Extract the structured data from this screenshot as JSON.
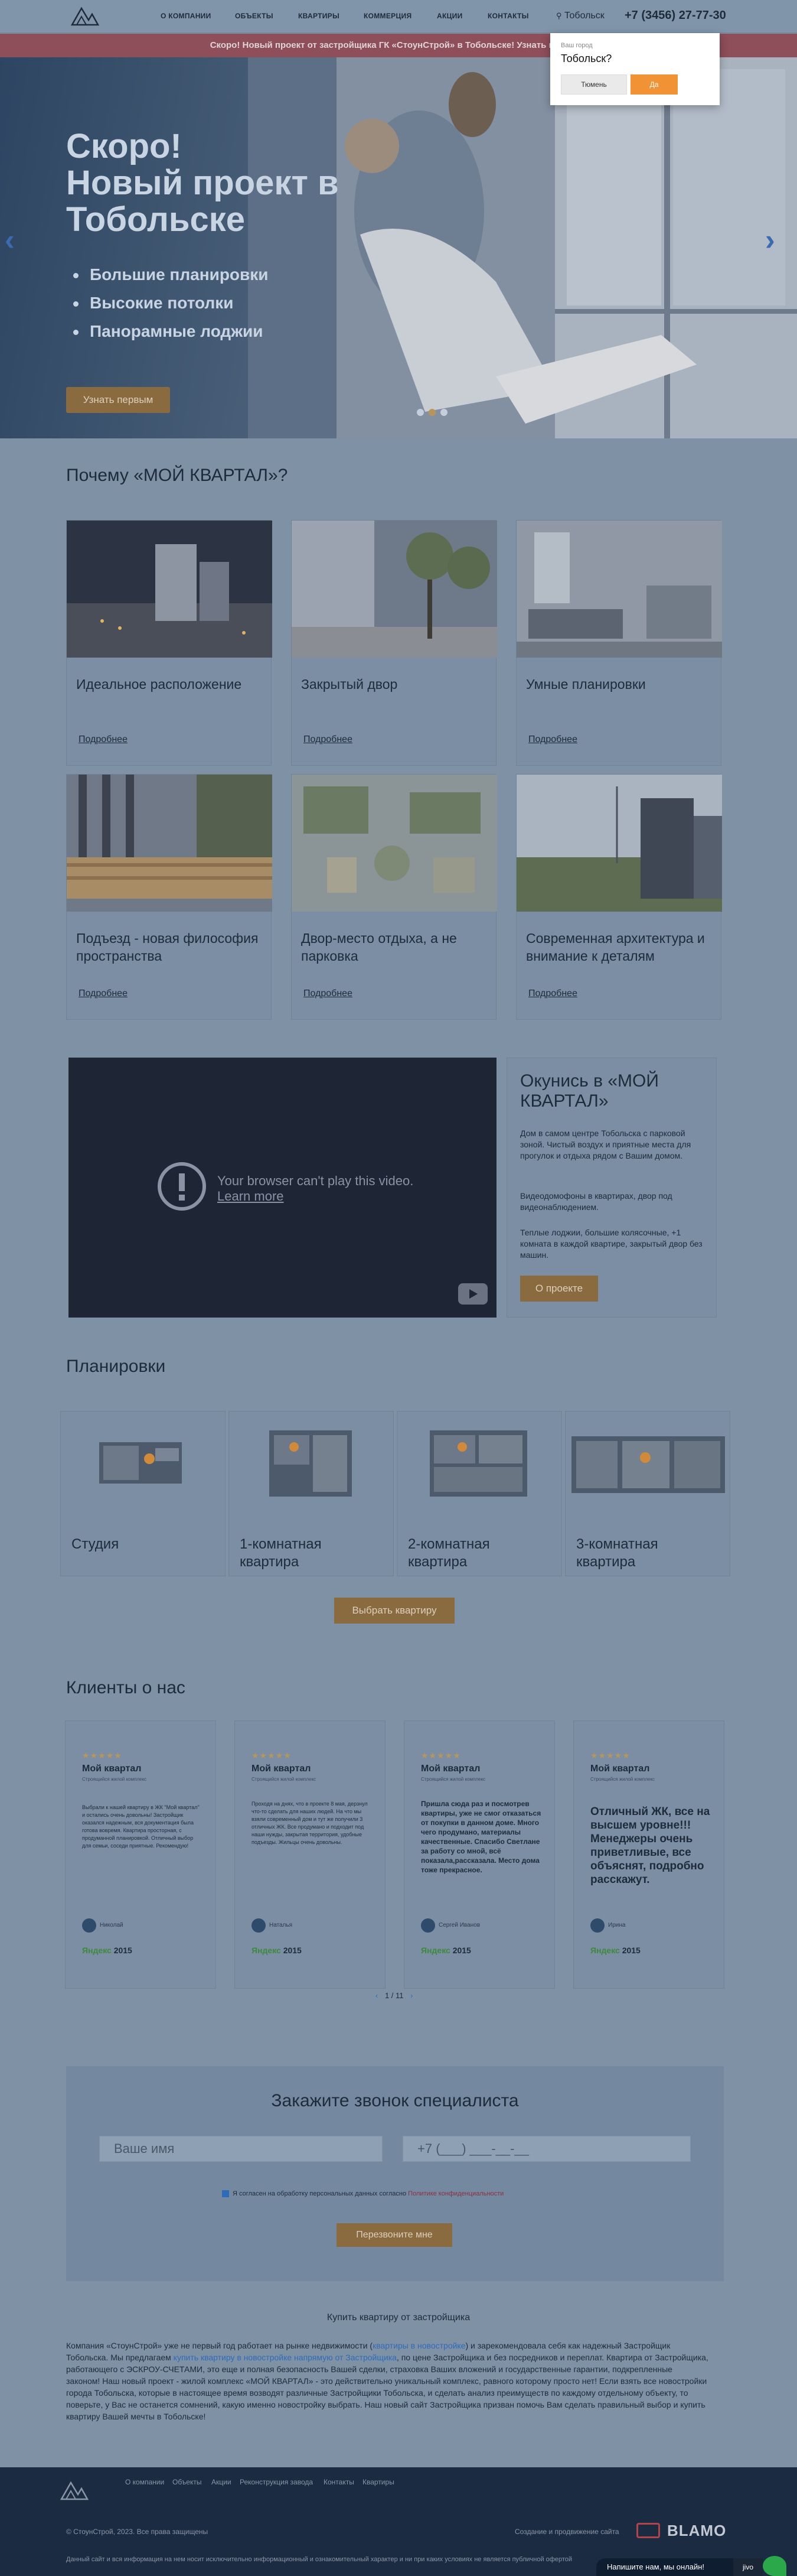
{
  "header": {
    "nav": [
      "О КОМПАНИИ",
      "ОБЪЕКТЫ",
      "КВАРТИРЫ",
      "КОММЕРЦИЯ",
      "АКЦИИ",
      "КОНТАКТЫ"
    ],
    "city": "Тобольск",
    "phone": "+7 (3456) 27-77-30"
  },
  "ticker": "Скоро! Новый проект от застройщика ГК «СтоунСтрой» в Тобольске! Узнать первым!",
  "city_popup": {
    "question": "Ваш город",
    "city": "Тобольск?",
    "no_label": "Тюмень",
    "yes_label": "Да"
  },
  "hero": {
    "title_lines": [
      "Скоро!",
      "Новый проект в",
      "Тобольске"
    ],
    "bullets": [
      "Большие планировки",
      "Высокие потолки",
      "Панорамные лоджии"
    ],
    "cta": "Узнать первым",
    "slides": 3,
    "active_slide": 2
  },
  "why": {
    "title": "Почему «МОЙ КВАРТАЛ»?",
    "more_label": "Подробнее",
    "cards": [
      {
        "title": "Идеальное расположение"
      },
      {
        "title": "Закрытый двор"
      },
      {
        "title": "Умные планировки"
      },
      {
        "title": "Подъезд - новая философия пространства"
      },
      {
        "title": "Двор-место отдыха, а не парковка"
      },
      {
        "title": "Современная архитектура и внимание к деталям"
      }
    ]
  },
  "video": {
    "message": "Your browser can't play this video.",
    "link": "Learn more"
  },
  "about": {
    "title": "Окунись в «МОЙ КВАРТАЛ»",
    "paragraphs": [
      "Дом в самом центре Тобольска с парковой зоной. Чистый воздух и приятные места для прогулок и отдыха рядом с Вашим домом.",
      "Видеодомофоны в квартирах, двор под видеонаблюдением.",
      "Теплые лоджии, большие колясочные, +1 комната в каждой квартире, закрытый двор без машин."
    ],
    "button": "О проекте"
  },
  "plans": {
    "title": "Планировки",
    "items": [
      "Студия",
      "1-комнатная квартира",
      "2-комнатная квартира",
      "3-комнатная квартира"
    ],
    "button": "Выбрать квартиру"
  },
  "reviews": {
    "title": "Клиенты о нас",
    "stars": "★★★★★",
    "source": "Яндекс",
    "items": [
      {
        "title": "Мой квартал",
        "subtitle": "Строящийся жилой комплекс",
        "text": "Выбрали к нашей квартиру в ЖК \"Мой квартал\" и остались очень довольны! Застройщик оказался надежным, вся документация была готова вовремя. Квартира просторная, с продуманной планировкой. Отличный выбор для семьи, соседи приятные. Рекомендую!",
        "author": "Николай",
        "rating": "2015"
      },
      {
        "title": "Мой квартал",
        "subtitle": "Строящийся жилой комплекс",
        "text": "Проходя на днях, что в проекте 8 мая, дерзнул что-то сделать для наших людей. На что мы взяли современный дом и тут же получили 3 отличных ЖК. Все продумано и подходит под наши нужды, закрытая территория, удобные подъезды. Жильцы очень довольны.",
        "author": "Наталья",
        "rating": "2015"
      },
      {
        "title": "Мой квартал",
        "subtitle": "Строящийся жилой комплекс",
        "text": "Пришла сюда раз и посмотрев квартиры, уже не смог отказаться от покупки в данном доме. Много чего продумано, материалы качественные. Спасибо Светлане за работу со мной, всё показала,рассказала. Место дома тоже прекрасное.",
        "author": "Сергей Иванов",
        "rating": "2015"
      },
      {
        "title": "Мой квартал",
        "subtitle": "Строящийся жилой комплекс",
        "text": "Отличный ЖК, все на высшем уровне!!! Менеджеры очень приветливые, все объяснят, подробно расскажут.",
        "author": "Ирина",
        "rating": "2015"
      }
    ],
    "pager": "1 / 11"
  },
  "callback": {
    "title": "Закажите звонок специалиста",
    "name_placeholder": "Ваше имя",
    "phone_placeholder": "+7 (___) ___-__-__",
    "consent": "Я согласен на обработку персональных данных согласно ",
    "consent_link": "Политике конфиденциальности",
    "button": "Перезвоните мне"
  },
  "seo": {
    "title": "Купить квартиру от застройщика",
    "p1": "Компания «СтоунСтрой» уже не первый год работает на рынке недвижимости (",
    "p1_link": "квартиры в новостройке",
    "p2": ") и зарекомендовала себя как надежный Застройщик Тобольска. Мы предлагаем ",
    "p2_link": "купить квартиру в новостройке напрямую от Застройщика",
    "p3": ", по цене Застройщика и без посредников и переплат. Квартира от Застройщика, работающего с ЭСКРОУ-СЧЕТАМИ, это еще и полная безопасность Вашей сделки, страховка Ваших вложений и государственные гарантии, подкрепленные законом! Наш новый проект - жилой комплекс «МОЙ КВАРТАЛ» - это действительно уникальный комплекс, равного которому просто нет! Если взять все новостройки города Тобольска, которые в настоящее время возводят различные Застройщики Тобольска, и сделать анализ преимуществ по каждому отдельному объекту, то поверьте, у Вас не останется сомнений, какую именно новостройку выбрать. Наш новый сайт Застройщика призван помочь Вам сделать правильный выбор и купить квартиру Вашей мечты в Тобольске!"
  },
  "footer": {
    "nav": [
      "О компании",
      "Объекты",
      "Акции",
      "Реконструкция завода",
      "Контакты",
      "Квартиры"
    ],
    "copyright": "© СтоунСтрой, 2023. Все права защищены",
    "developer": "Создание и продвижение сайта",
    "developer_brand": "BLAMO",
    "note": "Данный сайт и вся информация на нем носит исключительно информационный и ознакомительный характер и ни при каких условиях не является публичной офертой"
  },
  "chat": {
    "label": "Напишите нам, мы онлайн!",
    "brand": "jivo"
  },
  "colors": {
    "accent": "#8a6b40",
    "ticker": "#8e4e5a",
    "footer": "#1b2b42",
    "popup_yes": "#f19335"
  }
}
